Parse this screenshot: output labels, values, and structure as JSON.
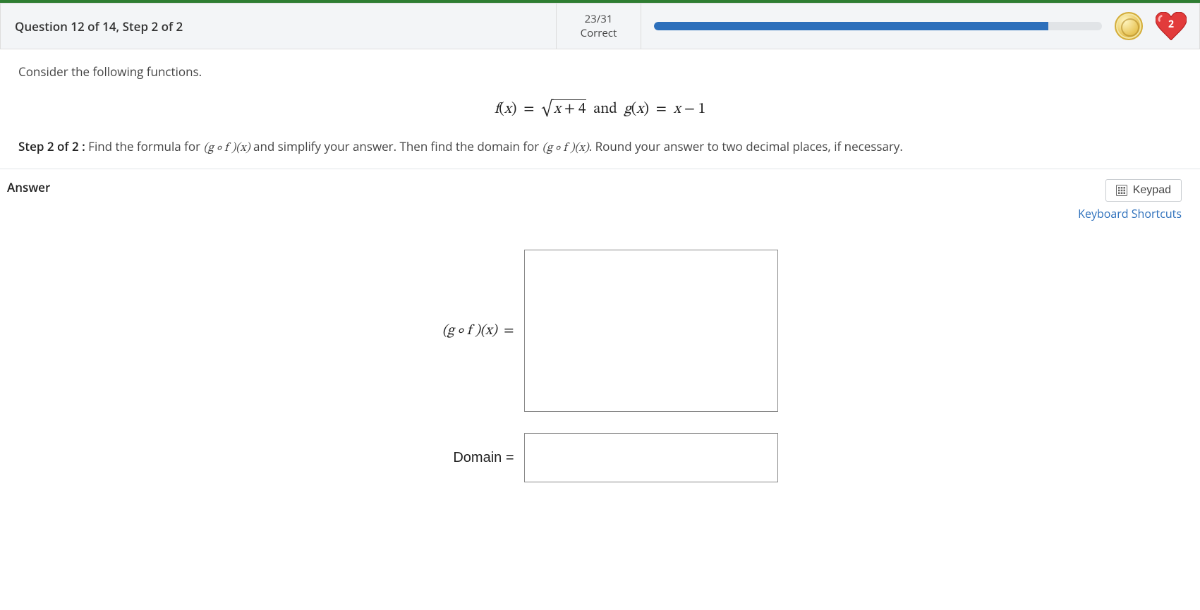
{
  "header": {
    "question_title": "Question 12 of 14, Step 2 of 2",
    "score_fraction": "23/31",
    "score_label": "Correct",
    "heart_count": "2"
  },
  "question": {
    "intro": "Consider the following functions.",
    "functions_html": "f(x) = √(x + 4) and g(x) = x − 1",
    "step_label": "Step 2 of 2 :",
    "step_text_1": "Find the formula for ",
    "gof_1": "(g ∘ f )(x)",
    "step_text_2": " and simplify your answer. Then find the domain for ",
    "gof_2": "(g ∘ f )(x)",
    "step_text_3": ". Round your answer to two decimal places, if necessary."
  },
  "answer": {
    "heading": "Answer",
    "keypad_label": "Keypad",
    "shortcuts_label": "Keyboard Shortcuts",
    "formula_label": "(g ∘ f )(x)  =",
    "domain_label": "Domain  =",
    "formula_value": "",
    "domain_value": ""
  }
}
